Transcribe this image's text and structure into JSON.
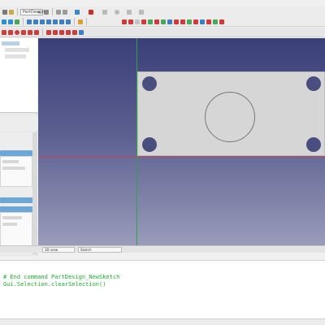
{
  "toolbar": {
    "workbench_combo": "PartDesign",
    "view_tabs": [
      "3D view",
      "Sketch"
    ]
  },
  "console": {
    "lines": [
      "# End command PartDesign_NewSketch",
      "Gui.Selection.clearSelection()"
    ]
  },
  "colors": {
    "viewport_top": "#3b3f79",
    "viewport_bottom": "#9a9cba",
    "axis_vertical": "#2fa24a",
    "axis_horizontal": "#c6435a",
    "plate": "#d6d6d6",
    "hole": "#4a4e7f",
    "console_text": "#1fae2c",
    "task_panel_header": "#6da7d8"
  },
  "icons": {
    "toolbar_row_1": [
      "new-file-icon",
      "open-icon",
      "save-icon",
      "undo-icon",
      "redo-icon",
      "refresh-icon",
      "close-icon",
      "macro-record-icon",
      "macro-stop-icon",
      "macro-run-icon",
      "help-icon"
    ],
    "toolbar_row_2": [
      "fit-all-icon",
      "fit-selection-icon",
      "draw-style-icon",
      "axonometric-icon",
      "front-view-icon",
      "top-view-icon",
      "right-view-icon",
      "rear-view-icon",
      "bottom-view-icon",
      "left-view-icon",
      "measure-icon",
      "sketch-icon",
      "pad-icon",
      "pocket-icon",
      "revolve-icon",
      "fillet-icon",
      "chamfer-icon",
      "mirror-icon"
    ],
    "toolbar_row_3": [
      "line-icon",
      "arc-icon",
      "circle-icon",
      "rectangle-icon",
      "polygon-icon",
      "slot-icon",
      "constraint-coincident-icon",
      "constraint-horizontal-icon",
      "constraint-vertical-icon",
      "constraint-distance-icon",
      "constraint-radius-icon",
      "constraint-angle-icon"
    ]
  }
}
